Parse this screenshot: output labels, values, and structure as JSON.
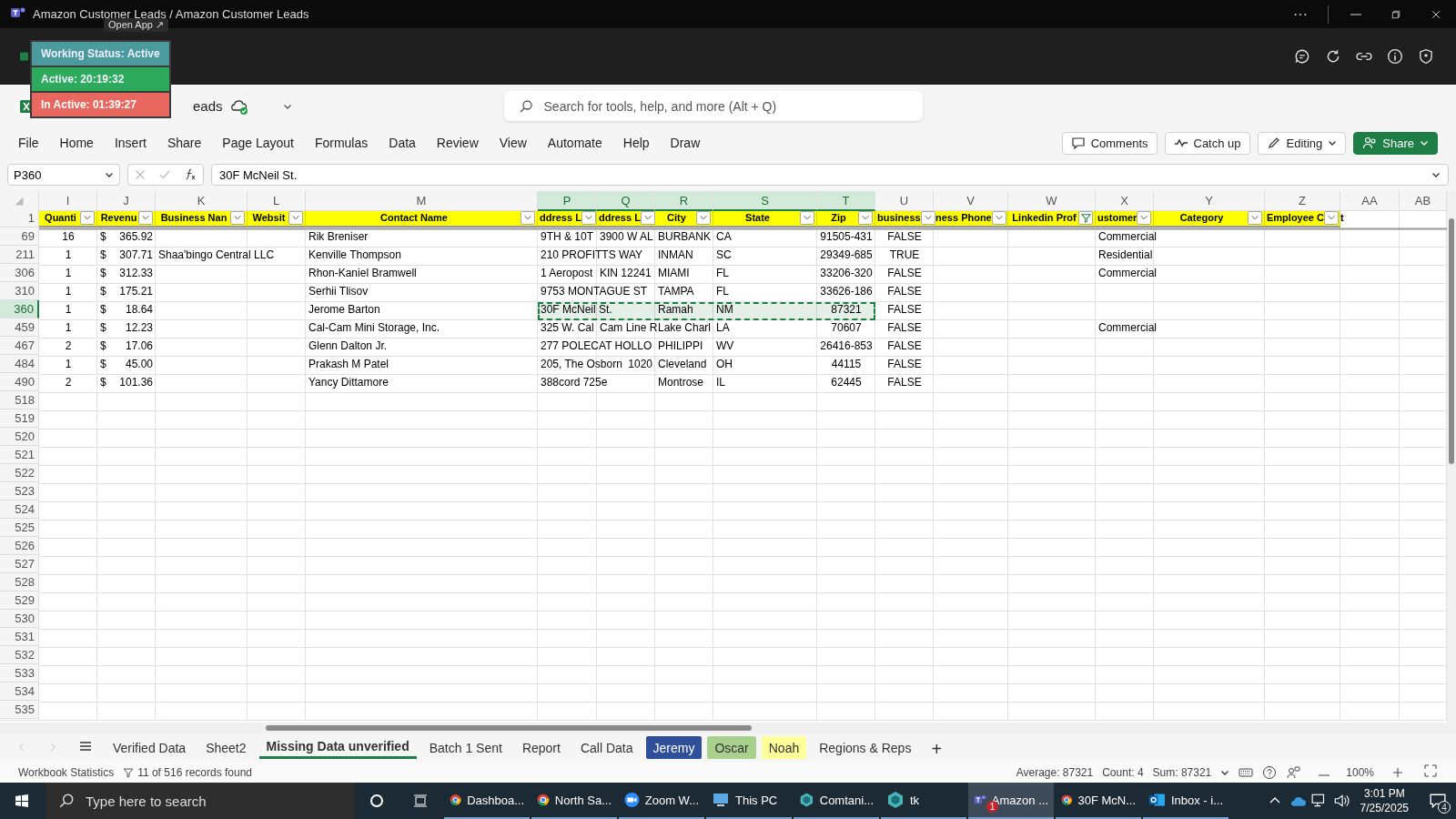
{
  "window": {
    "title": "Amazon Customer Leads / Amazon Customer Leads",
    "more": "···"
  },
  "status_widget": {
    "tooltip": "Open App ↗",
    "title": "Working Status: Active",
    "active": "Active: 20:19:32",
    "inactive": "In Active: 01:39:27"
  },
  "file_name_visible": "eads",
  "search": {
    "placeholder": "Search for tools, help, and more (Alt + Q)"
  },
  "ribbon_tabs": [
    "File",
    "Home",
    "Insert",
    "Share",
    "Page Layout",
    "Formulas",
    "Data",
    "Review",
    "View",
    "Automate",
    "Help",
    "Draw"
  ],
  "ribbon_buttons": [
    {
      "label": "Comments",
      "kind": "comments"
    },
    {
      "label": "Catch up",
      "kind": "catchup"
    },
    {
      "label": "Editing",
      "kind": "editing"
    },
    {
      "label": "Share",
      "kind": "share"
    }
  ],
  "formula_bar": {
    "cell": "P360",
    "value": "30F McNeil St."
  },
  "columns": [
    {
      "letter": "I",
      "kind": "center",
      "selected": false
    },
    {
      "letter": "J",
      "kind": "currency",
      "selected": false
    },
    {
      "letter": "K",
      "kind": "text",
      "selected": false
    },
    {
      "letter": "L",
      "kind": "text",
      "selected": false
    },
    {
      "letter": "M",
      "kind": "text",
      "selected": false
    },
    {
      "letter": "P",
      "kind": "text",
      "selected": true
    },
    {
      "letter": "Q",
      "kind": "text",
      "selected": true
    },
    {
      "letter": "R",
      "kind": "text",
      "selected": true
    },
    {
      "letter": "S",
      "kind": "text",
      "selected": true
    },
    {
      "letter": "T",
      "kind": "center",
      "selected": true
    },
    {
      "letter": "U",
      "kind": "center",
      "selected": false
    },
    {
      "letter": "V",
      "kind": "text",
      "selected": false
    },
    {
      "letter": "W",
      "kind": "text",
      "selected": false
    },
    {
      "letter": "X",
      "kind": "text",
      "selected": false
    },
    {
      "letter": "Y",
      "kind": "text",
      "selected": false
    },
    {
      "letter": "Z",
      "kind": "text",
      "selected": false
    },
    {
      "letter": "AA",
      "kind": "text",
      "selected": false
    },
    {
      "letter": "AB",
      "kind": "text",
      "selected": false
    }
  ],
  "header_row": {
    "num": "1",
    "filters": [
      {
        "label": "Quanti",
        "filtered": false
      },
      {
        "label": "Revenu",
        "filtered": false
      },
      {
        "label": "Business Nan",
        "filtered": false
      },
      {
        "label": "Websit",
        "filtered": false
      },
      {
        "label": "Contact Name",
        "filtered": false
      },
      {
        "label": "ddress L",
        "filtered": false
      },
      {
        "label": "ddress L",
        "filtered": false
      },
      {
        "label": "City",
        "filtered": false
      },
      {
        "label": "State",
        "filtered": false
      },
      {
        "label": "Zip",
        "filtered": false
      },
      {
        "label": "business",
        "filtered": false
      },
      {
        "label": "ness Phone",
        "filtered": false
      },
      {
        "label": "Linkedin Prof",
        "filtered": true
      },
      {
        "label": "ustomer",
        "filtered": false
      },
      {
        "label": "Category",
        "filtered": false
      },
      {
        "label": "Employee C",
        "filtered": false,
        "tail": "t"
      }
    ]
  },
  "rows": [
    {
      "num": "69",
      "selected": false,
      "currency": "$",
      "cells": [
        "16",
        "365.92",
        "",
        "",
        "Rik Breniser",
        "9TH & 10T",
        "3900 W AL",
        "BURBANK",
        "CA",
        "91505-431",
        "FALSE",
        "",
        "",
        "Commercial",
        "",
        "",
        "",
        ""
      ]
    },
    {
      "num": "211",
      "selected": false,
      "currency": "$",
      "cells": [
        "1",
        "307.71",
        "Shaa'bingo Central LLC",
        "",
        "Kenville Thompson",
        "210 PROFITTS WAY",
        "",
        "INMAN",
        "SC",
        "29349-685",
        "TRUE",
        "",
        "",
        "Residential",
        "",
        "",
        "",
        ""
      ]
    },
    {
      "num": "306",
      "selected": false,
      "currency": "$",
      "cells": [
        "1",
        "312.33",
        "",
        "",
        "Rhon-Kaniel Bramwell",
        "1 Aeropost",
        "KIN 12241",
        "MIAMI",
        "FL",
        "33206-320",
        "FALSE",
        "",
        "",
        "Commercial",
        "",
        "",
        "",
        ""
      ]
    },
    {
      "num": "310",
      "selected": false,
      "currency": "$",
      "cells": [
        "1",
        "175.21",
        "",
        "",
        "Serhii Tlisov",
        "9753 MONTAGUE ST",
        "",
        "TAMPA",
        "FL",
        "33626-186",
        "FALSE",
        "",
        "",
        "",
        "",
        "",
        "",
        ""
      ]
    },
    {
      "num": "360",
      "selected": true,
      "currency": "$",
      "cells": [
        "1",
        "18.64",
        "",
        "",
        "Jerome Barton",
        "30F McNeil St.",
        "",
        "Ramah",
        "NM",
        "87321",
        "FALSE",
        "",
        "",
        "",
        "",
        "",
        "",
        ""
      ]
    },
    {
      "num": "459",
      "selected": false,
      "currency": "$",
      "cells": [
        "1",
        "12.23",
        "",
        "",
        "Cal-Cam Mini Storage, Inc.",
        "325 W. Cal",
        "Cam Line R",
        "Lake Charl",
        "LA",
        "70607",
        "FALSE",
        "",
        "",
        "Commercial",
        "",
        "",
        "",
        ""
      ]
    },
    {
      "num": "467",
      "selected": false,
      "currency": "$",
      "cells": [
        "2",
        "17.06",
        "",
        "",
        "Glenn Dalton Jr.",
        "277 POLECAT HOLLO",
        "",
        "PHILIPPI",
        "WV",
        "26416-853",
        "FALSE",
        "",
        "",
        "",
        "",
        "",
        "",
        ""
      ]
    },
    {
      "num": "484",
      "selected": false,
      "currency": "$",
      "cells": [
        "1",
        "45.00",
        "",
        "",
        "Prakash M Patel",
        "205, The Osborn",
        {
          "text": "1020",
          "kind": "right"
        },
        "Cleveland",
        "OH",
        "44115",
        "FALSE",
        "",
        "",
        "",
        "",
        "",
        "",
        ""
      ]
    },
    {
      "num": "490",
      "selected": false,
      "currency": "$",
      "cells": [
        "2",
        "101.36",
        "",
        "",
        "Yancy Dittamore",
        "388cord 725e",
        "",
        "Montrose",
        "IL",
        "62445",
        "FALSE",
        "",
        "",
        "",
        "",
        "",
        "",
        ""
      ]
    }
  ],
  "empty_rows": [
    "518",
    "519",
    "520",
    "521",
    "522",
    "523",
    "524",
    "525",
    "526",
    "527",
    "528",
    "529",
    "530",
    "531",
    "532",
    "533",
    "534",
    "535"
  ],
  "sheet_tabs": [
    {
      "label": "Verified Data",
      "selected": false
    },
    {
      "label": "Sheet2",
      "selected": false
    },
    {
      "label": "Missing Data unverified",
      "selected": true
    },
    {
      "label": "Batch 1 Sent",
      "selected": false
    },
    {
      "label": "Report",
      "selected": false
    },
    {
      "label": "Call Data",
      "selected": false
    },
    {
      "label": "Jeremy",
      "selected": false,
      "color": "#2f4f9a"
    },
    {
      "label": "Oscar",
      "selected": false,
      "color": "#a9d18e"
    },
    {
      "label": "Noah",
      "selected": false,
      "color": "#ffff99"
    },
    {
      "label": "Regions & Reps",
      "selected": false
    }
  ],
  "add_sheet": "+",
  "status_bar": {
    "left": "Workbook Statistics",
    "records": "11 of 516 records found",
    "average": "Average: 87321",
    "count": "Count: 4",
    "sum": "Sum: 87321",
    "zoom": "100%"
  },
  "taskbar": {
    "search_placeholder": "Type here to search",
    "items": [
      {
        "label": "Dashboa...",
        "kind": "chrome",
        "selected": false
      },
      {
        "label": "North Sa...",
        "kind": "chrome",
        "selected": false
      },
      {
        "label": "Zoom W...",
        "kind": "zoom",
        "selected": false
      },
      {
        "label": "This PC",
        "kind": "pc",
        "selected": false
      },
      {
        "label": "Comtani...",
        "kind": "app",
        "selected": false
      },
      {
        "label": "tk",
        "kind": "app",
        "selected": false
      },
      {
        "label": "Amazon ...",
        "kind": "teams",
        "selected": true,
        "badge": "1"
      },
      {
        "label": "30F McN...",
        "kind": "chrome",
        "selected": false
      },
      {
        "label": "Inbox - i...",
        "kind": "outlook",
        "selected": false
      }
    ],
    "time": "3:01 PM",
    "date": "7/25/2025",
    "notifications": "4"
  }
}
